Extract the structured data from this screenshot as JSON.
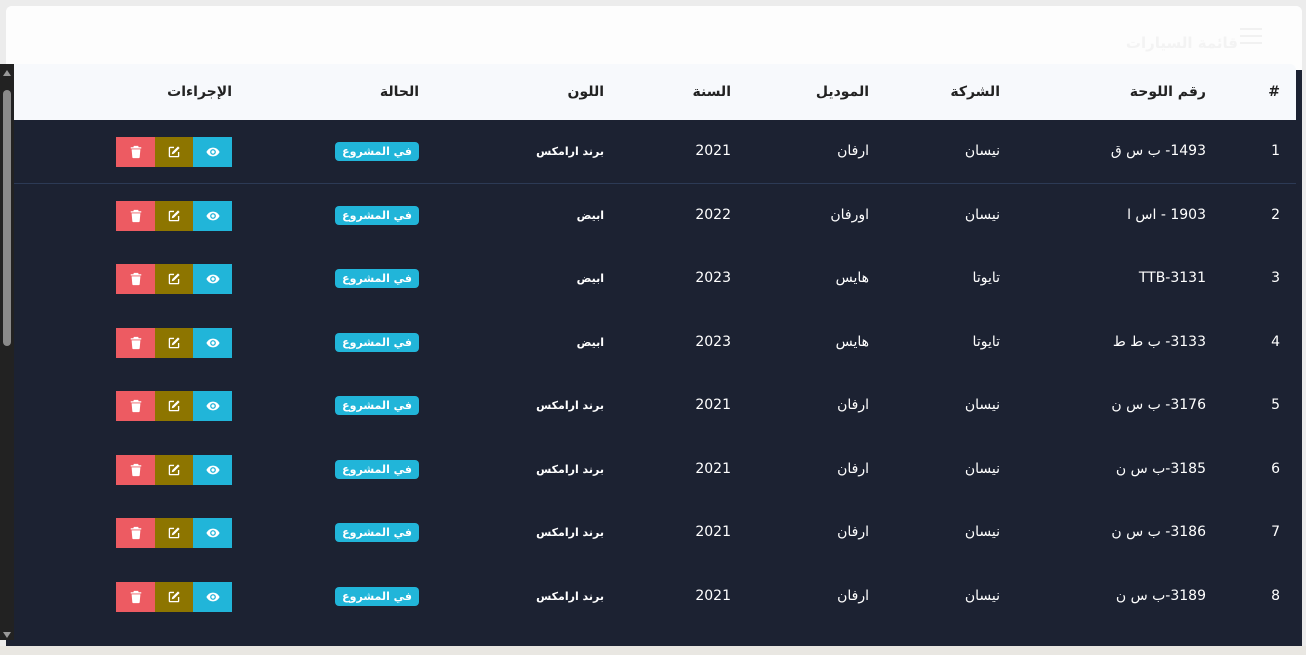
{
  "header": {
    "title": "قائمة السيارات",
    "menu_icon": "menu-icon"
  },
  "table": {
    "columns": [
      "#",
      "رقم اللوحة",
      "الشركة",
      "الموديل",
      "السنة",
      "اللون",
      "الحالة",
      "الإجراءات"
    ],
    "rows": [
      {
        "num": "1",
        "plate": "1493- ب س ق",
        "company": "نيسان",
        "model": "ارفان",
        "year": "2021",
        "color": "برند ارامكس",
        "status": "في المشروع"
      },
      {
        "num": "2",
        "plate": "1903 - اس ا",
        "company": "نيسان",
        "model": "اورفان",
        "year": "2022",
        "color": "ابيض",
        "status": "في المشروع"
      },
      {
        "num": "3",
        "plate": "TTB-3131",
        "company": "تايوتا",
        "model": "هايس",
        "year": "2023",
        "color": "ابيض",
        "status": "في المشروع"
      },
      {
        "num": "4",
        "plate": "3133- ب ط ط",
        "company": "تايوتا",
        "model": "هايس",
        "year": "2023",
        "color": "ابيض",
        "status": "في المشروع"
      },
      {
        "num": "5",
        "plate": "3176- ب س ن",
        "company": "نيسان",
        "model": "ارفان",
        "year": "2021",
        "color": "برند ارامكس",
        "status": "في المشروع"
      },
      {
        "num": "6",
        "plate": "3185-ب س ن",
        "company": "نيسان",
        "model": "ارفان",
        "year": "2021",
        "color": "برند ارامكس",
        "status": "في المشروع"
      },
      {
        "num": "7",
        "plate": "3186- ب س ن",
        "company": "نيسان",
        "model": "ارفان",
        "year": "2021",
        "color": "برند ارامكس",
        "status": "في المشروع"
      },
      {
        "num": "8",
        "plate": "3189-ب س ن",
        "company": "نيسان",
        "model": "ارفان",
        "year": "2021",
        "color": "برند ارامكس",
        "status": "في المشروع"
      }
    ],
    "action_icons": [
      "eye-icon",
      "edit-icon",
      "trash-icon"
    ]
  },
  "colors": {
    "table_bg": "#1c2232",
    "header_bg": "#f7f9fc",
    "badge": "#21b5d9",
    "view": "#21b5d9",
    "edit": "#8d7500",
    "delete": "#ed5b62"
  }
}
